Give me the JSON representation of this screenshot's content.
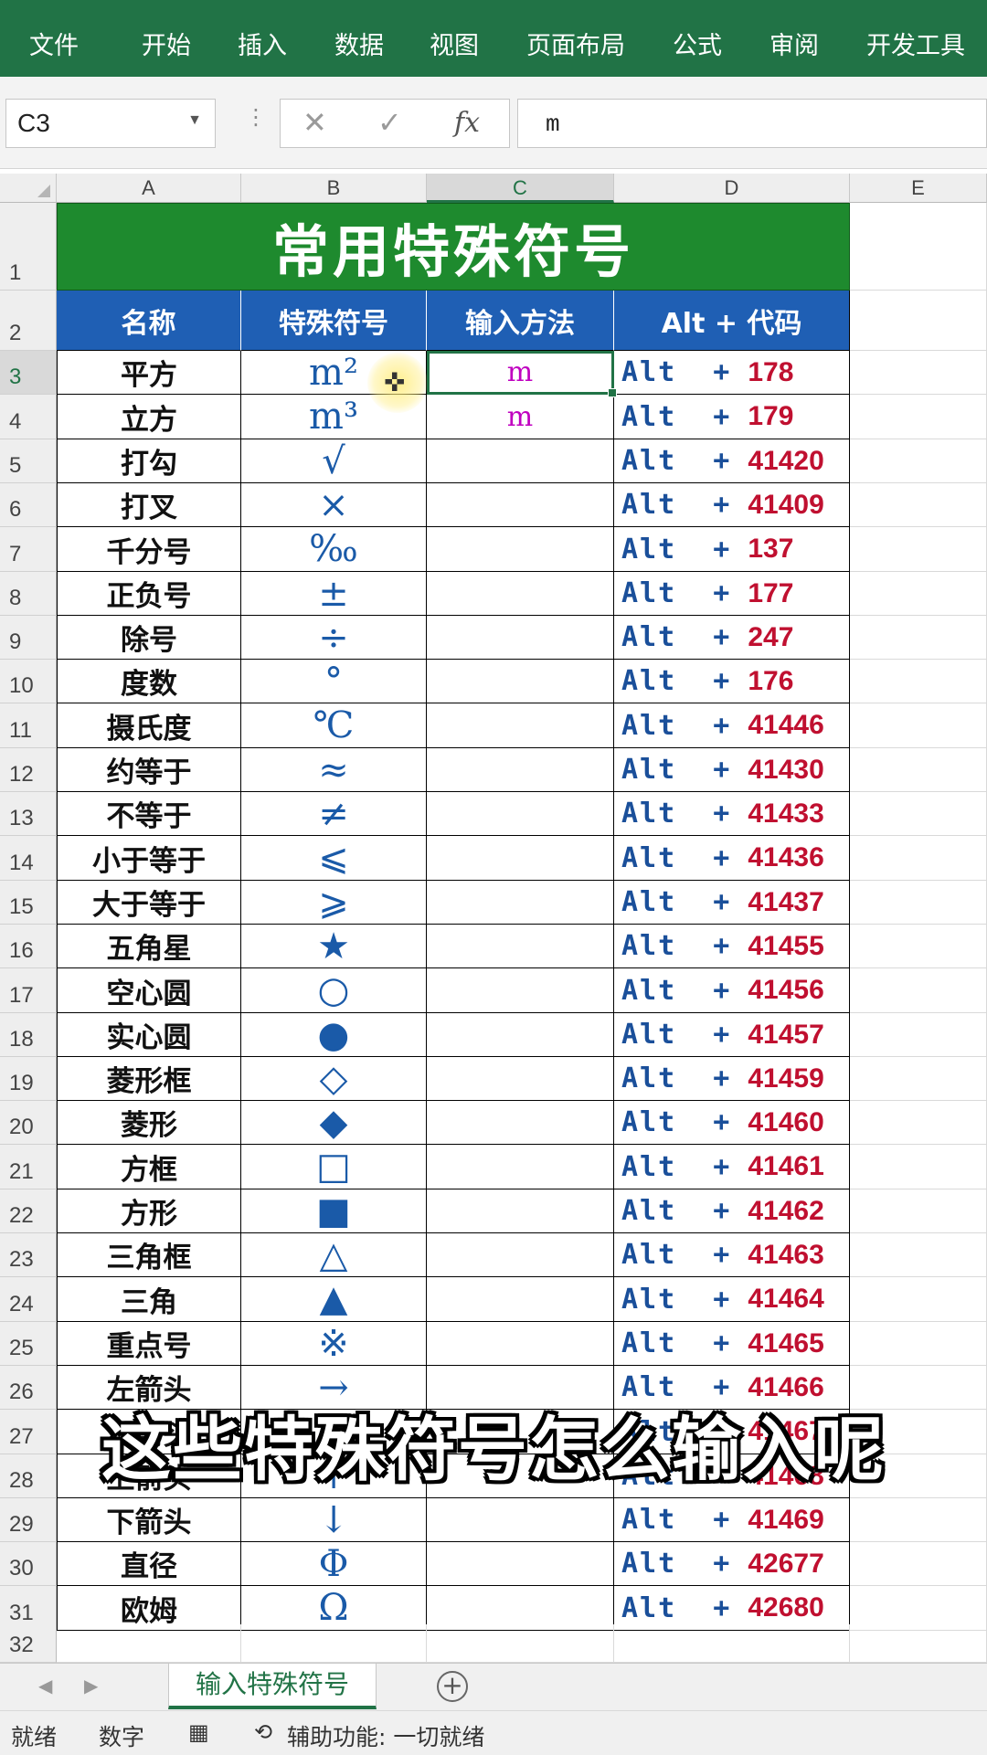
{
  "ribbon": {
    "tabs": [
      "文件",
      "开始",
      "插入",
      "数据",
      "视图",
      "页面布局",
      "公式",
      "审阅",
      "开发工具"
    ]
  },
  "formula_bar": {
    "name_box": "C3",
    "cancel_icon": "✕",
    "enter_icon": "✓",
    "fx_label": "fx",
    "value": "m"
  },
  "columns": [
    "A",
    "B",
    "C",
    "D",
    "E"
  ],
  "rows": [
    "1",
    "2",
    "3",
    "4",
    "5",
    "6",
    "7",
    "8",
    "9",
    "10",
    "11",
    "12",
    "13",
    "14",
    "15",
    "16",
    "17",
    "18",
    "19",
    "20",
    "21",
    "22",
    "23",
    "24",
    "25",
    "26",
    "27",
    "28",
    "29",
    "30",
    "31",
    "32"
  ],
  "sheet": {
    "title": "常用特殊符号",
    "headers": [
      "名称",
      "特殊符号",
      "输入方法",
      "Alt + 代码"
    ],
    "alt_label": "Alt  +",
    "data": [
      {
        "name": "平方",
        "symbol": "m²",
        "input": "m",
        "code": "178"
      },
      {
        "name": "立方",
        "symbol": "m³",
        "input": "m",
        "code": "179"
      },
      {
        "name": "打勾",
        "symbol": "√",
        "input": "",
        "code": "41420"
      },
      {
        "name": "打叉",
        "symbol": "×",
        "input": "",
        "code": "41409"
      },
      {
        "name": "千分号",
        "symbol": "‰",
        "input": "",
        "code": "137"
      },
      {
        "name": "正负号",
        "symbol": "±",
        "input": "",
        "code": "177"
      },
      {
        "name": "除号",
        "symbol": "÷",
        "input": "",
        "code": "247"
      },
      {
        "name": "度数",
        "symbol": "°",
        "input": "",
        "code": "176"
      },
      {
        "name": "摄氏度",
        "symbol": "℃",
        "input": "",
        "code": "41446"
      },
      {
        "name": "约等于",
        "symbol": "≈",
        "input": "",
        "code": "41430"
      },
      {
        "name": "不等于",
        "symbol": "≠",
        "input": "",
        "code": "41433"
      },
      {
        "name": "小于等于",
        "symbol": "⩽",
        "input": "",
        "code": "41436"
      },
      {
        "name": "大于等于",
        "symbol": "⩾",
        "input": "",
        "code": "41437"
      },
      {
        "name": "五角星",
        "symbol": "★",
        "input": "",
        "code": "41455"
      },
      {
        "name": "空心圆",
        "symbol": "○",
        "input": "",
        "code": "41456"
      },
      {
        "name": "实心圆",
        "symbol": "●",
        "input": "",
        "code": "41457"
      },
      {
        "name": "菱形框",
        "symbol": "◇",
        "input": "",
        "code": "41459"
      },
      {
        "name": "菱形",
        "symbol": "◆",
        "input": "",
        "code": "41460"
      },
      {
        "name": "方框",
        "symbol": "□",
        "input": "",
        "code": "41461"
      },
      {
        "name": "方形",
        "symbol": "■",
        "input": "",
        "code": "41462"
      },
      {
        "name": "三角框",
        "symbol": "△",
        "input": "",
        "code": "41463"
      },
      {
        "name": "三角",
        "symbol": "▲",
        "input": "",
        "code": "41464"
      },
      {
        "name": "重点号",
        "symbol": "※",
        "input": "",
        "code": "41465"
      },
      {
        "name": "左箭头",
        "symbol": "→",
        "input": "",
        "code": "41466"
      },
      {
        "name": "右箭头",
        "symbol": "←",
        "input": "",
        "code": "41467"
      },
      {
        "name": "上箭头",
        "symbol": "↑",
        "input": "",
        "code": "41468"
      },
      {
        "name": "下箭头",
        "symbol": "↓",
        "input": "",
        "code": "41469"
      },
      {
        "name": "直径",
        "symbol": "Φ",
        "input": "",
        "code": "42677"
      },
      {
        "name": "欧姆",
        "symbol": "Ω",
        "input": "",
        "code": "42680"
      }
    ]
  },
  "subtitle": "这些特殊符号怎么输入呢",
  "sheet_tabs": {
    "active": "输入特殊符号",
    "add_icon": "+"
  },
  "status": {
    "ready": "就绪",
    "mode": "数字",
    "accessibility": "辅助功能: 一切就绪"
  },
  "colors": {
    "ribbon": "#217346",
    "title_bg": "#1e8a2e",
    "header_bg": "#1f5fb4",
    "symbol": "#1a5aa8",
    "alt": "#1a4f9a",
    "code": "#c01030",
    "input": "#c000c0"
  }
}
